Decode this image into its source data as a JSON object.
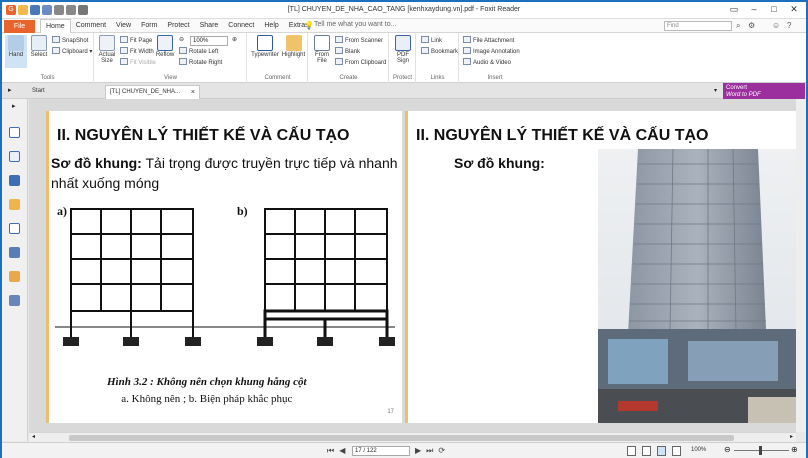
{
  "window": {
    "title": "[TL] CHUYEN_DE_NHA_CAO_TANG [kenhxaydung.vn].pdf - Foxit Reader",
    "tell_me": "Tell me what you want to...",
    "find_placeholder": "Find"
  },
  "menu": {
    "file": "File",
    "tabs": [
      "Home",
      "Comment",
      "View",
      "Form",
      "Protect",
      "Share",
      "Connect",
      "Help",
      "Extras"
    ],
    "active": "Home"
  },
  "ribbon": {
    "tools": {
      "label": "Tools",
      "hand": "Hand",
      "select": "Select",
      "snapshot": "SnapShot",
      "clipboard": "Clipboard"
    },
    "view": {
      "label": "View",
      "actual_size": "Actual Size",
      "fit_page": "Fit Page",
      "fit_width": "Fit Width",
      "fit_visible": "Fit Visible",
      "reflow": "Reflow",
      "zoom": "100%",
      "rotate_left": "Rotate Left",
      "rotate_right": "Rotate Right"
    },
    "comment": {
      "label": "Comment",
      "typewriter": "Typewriter",
      "highlight": "Highlight"
    },
    "create": {
      "label": "Create",
      "from_file": "From File",
      "from_scanner": "From Scanner",
      "blank": "Blank",
      "from_clipboard": "From Clipboard"
    },
    "protect": {
      "label": "Protect",
      "pdf_sign": "PDF Sign"
    },
    "links": {
      "label": "Links",
      "link": "Link",
      "bookmark": "Bookmark"
    },
    "insert": {
      "label": "Insert",
      "file_attachment": "File Attachment",
      "image_annotation": "Image Annotation",
      "audio_video": "Audio & Video"
    }
  },
  "doc_tabs": {
    "start": "Start",
    "doc": "[TL] CHUYEN_DE_NHA..."
  },
  "convert_banner": {
    "line1": "Convert",
    "line2": "Word to PDF"
  },
  "page1": {
    "heading": "II. NGUYÊN LÝ THIẾT KẾ VÀ CẤU TẠO",
    "sub_bold": "Sơ đồ khung:",
    "sub_text": " Tải trọng được truyền trực tiếp và nhanh nhất xuống móng",
    "fig_a": "a)",
    "fig_b": "b)",
    "caption1": "Hình 3.2 : Không nên chọn khung hẫng cột",
    "caption2": "a. Không nên ; b. Biện pháp khắc phục",
    "page_number": "17"
  },
  "page2": {
    "heading": "II. NGUYÊN LÝ THIẾT KẾ VÀ CẤU TẠO",
    "sub_bold": "Sơ đồ khung:"
  },
  "status": {
    "page": "17 / 122",
    "zoom": "100%"
  },
  "colors": {
    "accent": "#1d6fbf",
    "file_tab": "#e8642c",
    "convert": "#9b2f9e",
    "page_border": "#e9bf71"
  }
}
